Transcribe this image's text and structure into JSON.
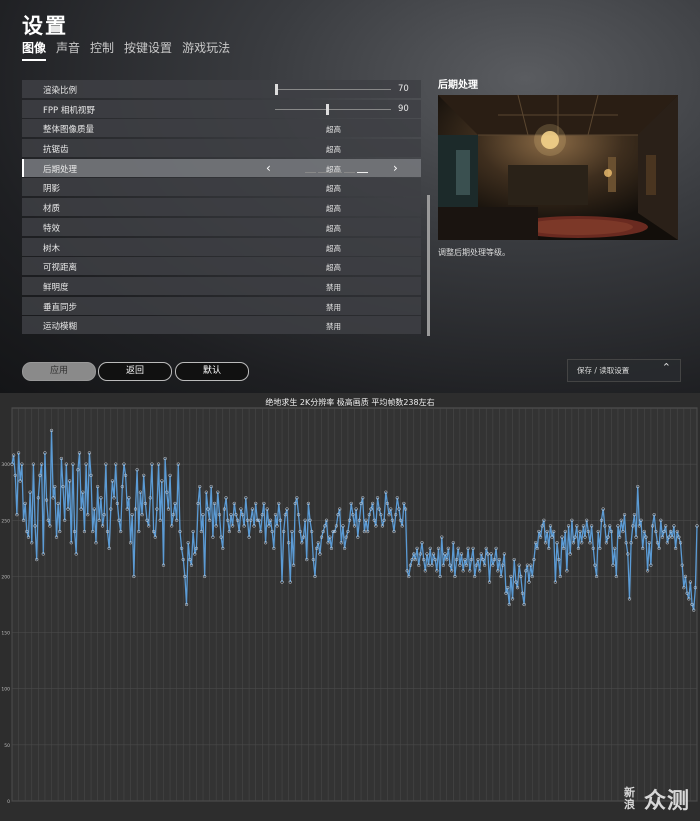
{
  "header": {
    "title": "设置"
  },
  "tabs": [
    {
      "label": "图像",
      "active": true
    },
    {
      "label": "声音",
      "active": false
    },
    {
      "label": "控制",
      "active": false
    },
    {
      "label": "按键设置",
      "active": false
    },
    {
      "label": "游戏玩法",
      "active": false
    }
  ],
  "settings": [
    {
      "label": "渲染比例",
      "kind": "slider",
      "value": "70",
      "level": 0
    },
    {
      "label": "FPP 相机视野",
      "kind": "slider",
      "value": "90",
      "level": 0.45
    },
    {
      "label": "整体图像质量",
      "kind": "option",
      "value": "超高"
    },
    {
      "label": "抗锯齿",
      "kind": "option",
      "value": "超高"
    },
    {
      "label": "后期处理",
      "kind": "selected",
      "value": "超高"
    },
    {
      "label": "阴影",
      "kind": "option",
      "value": "超高"
    },
    {
      "label": "材质",
      "kind": "option",
      "value": "超高"
    },
    {
      "label": "特效",
      "kind": "option",
      "value": "超高"
    },
    {
      "label": "树木",
      "kind": "option",
      "value": "超高"
    },
    {
      "label": "可视距离",
      "kind": "option",
      "value": "超高"
    },
    {
      "label": "鲜明度",
      "kind": "option",
      "value": "禁用"
    },
    {
      "label": "垂直同步",
      "kind": "option",
      "value": "禁用"
    },
    {
      "label": "运动模糊",
      "kind": "option",
      "value": "禁用"
    }
  ],
  "preview": {
    "title": "后期处理",
    "description": "调整后期处理等级。"
  },
  "buttons": {
    "apply": "应用",
    "back": "返回",
    "default": "默认"
  },
  "save_load": {
    "label": "保存 / 读取设置"
  },
  "watermark": {
    "text_stack": "新浪",
    "text_main": "众测"
  },
  "chart_data": {
    "type": "line",
    "title": "绝地求生 2K分辨率 极高画质 平均帧数238左右",
    "ylim": [
      0,
      350
    ],
    "yticks": [
      0,
      50,
      100,
      150,
      200,
      250,
      300
    ],
    "grid": true,
    "color": "#5b9bd5",
    "series": [
      {
        "values": [
          300,
          308,
          290,
          255,
          310,
          285,
          300,
          250,
          265,
          240,
          235,
          275,
          230,
          300,
          245,
          215,
          270,
          290,
          300,
          220,
          310,
          268,
          250,
          245,
          330,
          270,
          280,
          235,
          265,
          240,
          305,
          280,
          250,
          300,
          260,
          285,
          230,
          300,
          240,
          220,
          295,
          310,
          260,
          275,
          240,
          300,
          255,
          310,
          290,
          240,
          260,
          230,
          280,
          250,
          270,
          245,
          255,
          300,
          240,
          225,
          260,
          285,
          270,
          300,
          265,
          250,
          240,
          280,
          300,
          290,
          260,
          270,
          230,
          255,
          200,
          260,
          295,
          240,
          275,
          255,
          290,
          265,
          250,
          245,
          270,
          300,
          240,
          235,
          260,
          300,
          250,
          285,
          210,
          305,
          275,
          260,
          290,
          245,
          255,
          265,
          250,
          300,
          240,
          225,
          215,
          200,
          175,
          230,
          215,
          210,
          240,
          220,
          225,
          265,
          280,
          240,
          255,
          200,
          275,
          260,
          250,
          280,
          235,
          265,
          245,
          275,
          255,
          235,
          225,
          260,
          270,
          250,
          240,
          255,
          245,
          265,
          255,
          250,
          240,
          260,
          255,
          245,
          270,
          250,
          235,
          250,
          260,
          245,
          265,
          250,
          250,
          240,
          255,
          265,
          230,
          260,
          245,
          250,
          240,
          225,
          255,
          245,
          265,
          250,
          195,
          240,
          255,
          260,
          230,
          195,
          240,
          210,
          265,
          270,
          255,
          240,
          230,
          235,
          250,
          215,
          265,
          250,
          240,
          215,
          200,
          225,
          230,
          220,
          235,
          240,
          245,
          250,
          230,
          235,
          225,
          240,
          240,
          245,
          255,
          260,
          230,
          245,
          225,
          235,
          240,
          250,
          265,
          255,
          245,
          260,
          235,
          250,
          265,
          270,
          240,
          250,
          240,
          255,
          260,
          265,
          250,
          245,
          270,
          260,
          255,
          245,
          250,
          275,
          265,
          255,
          260,
          250,
          240,
          255,
          270,
          260,
          250,
          245,
          265,
          260,
          205,
          200,
          210,
          215,
          220,
          215,
          225,
          210,
          220,
          230,
          215,
          205,
          220,
          210,
          225,
          210,
          220,
          215,
          205,
          225,
          200,
          235,
          210,
          220,
          215,
          225,
          210,
          205,
          230,
          200,
          215,
          225,
          210,
          220,
          205,
          215,
          210,
          225,
          205,
          215,
          225,
          200,
          210,
          215,
          205,
          220,
          215,
          210,
          225,
          220,
          195,
          220,
          210,
          215,
          225,
          205,
          215,
          200,
          210,
          220,
          185,
          190,
          175,
          200,
          180,
          215,
          195,
          190,
          210,
          200,
          185,
          175,
          205,
          210,
          195,
          210,
          200,
          215,
          230,
          225,
          240,
          235,
          245,
          250,
          230,
          240,
          225,
          245,
          235,
          240,
          195,
          230,
          215,
          200,
          235,
          225,
          240,
          205,
          245,
          220,
          250,
          230,
          235,
          245,
          225,
          240,
          230,
          245,
          235,
          250,
          240,
          230,
          245,
          225,
          210,
          200,
          240,
          225,
          250,
          260,
          245,
          230,
          235,
          245,
          240,
          210,
          225,
          200,
          245,
          235,
          250,
          240,
          255,
          230,
          220,
          180,
          230,
          245,
          255,
          235,
          280,
          245,
          250,
          225,
          240,
          235,
          205,
          230,
          210,
          245,
          255,
          240,
          230,
          225,
          250,
          235,
          240,
          245,
          230,
          235,
          240,
          235,
          245,
          225,
          240,
          235,
          230,
          210,
          190,
          200,
          185,
          180,
          195,
          175,
          170,
          190,
          245
        ]
      }
    ]
  }
}
